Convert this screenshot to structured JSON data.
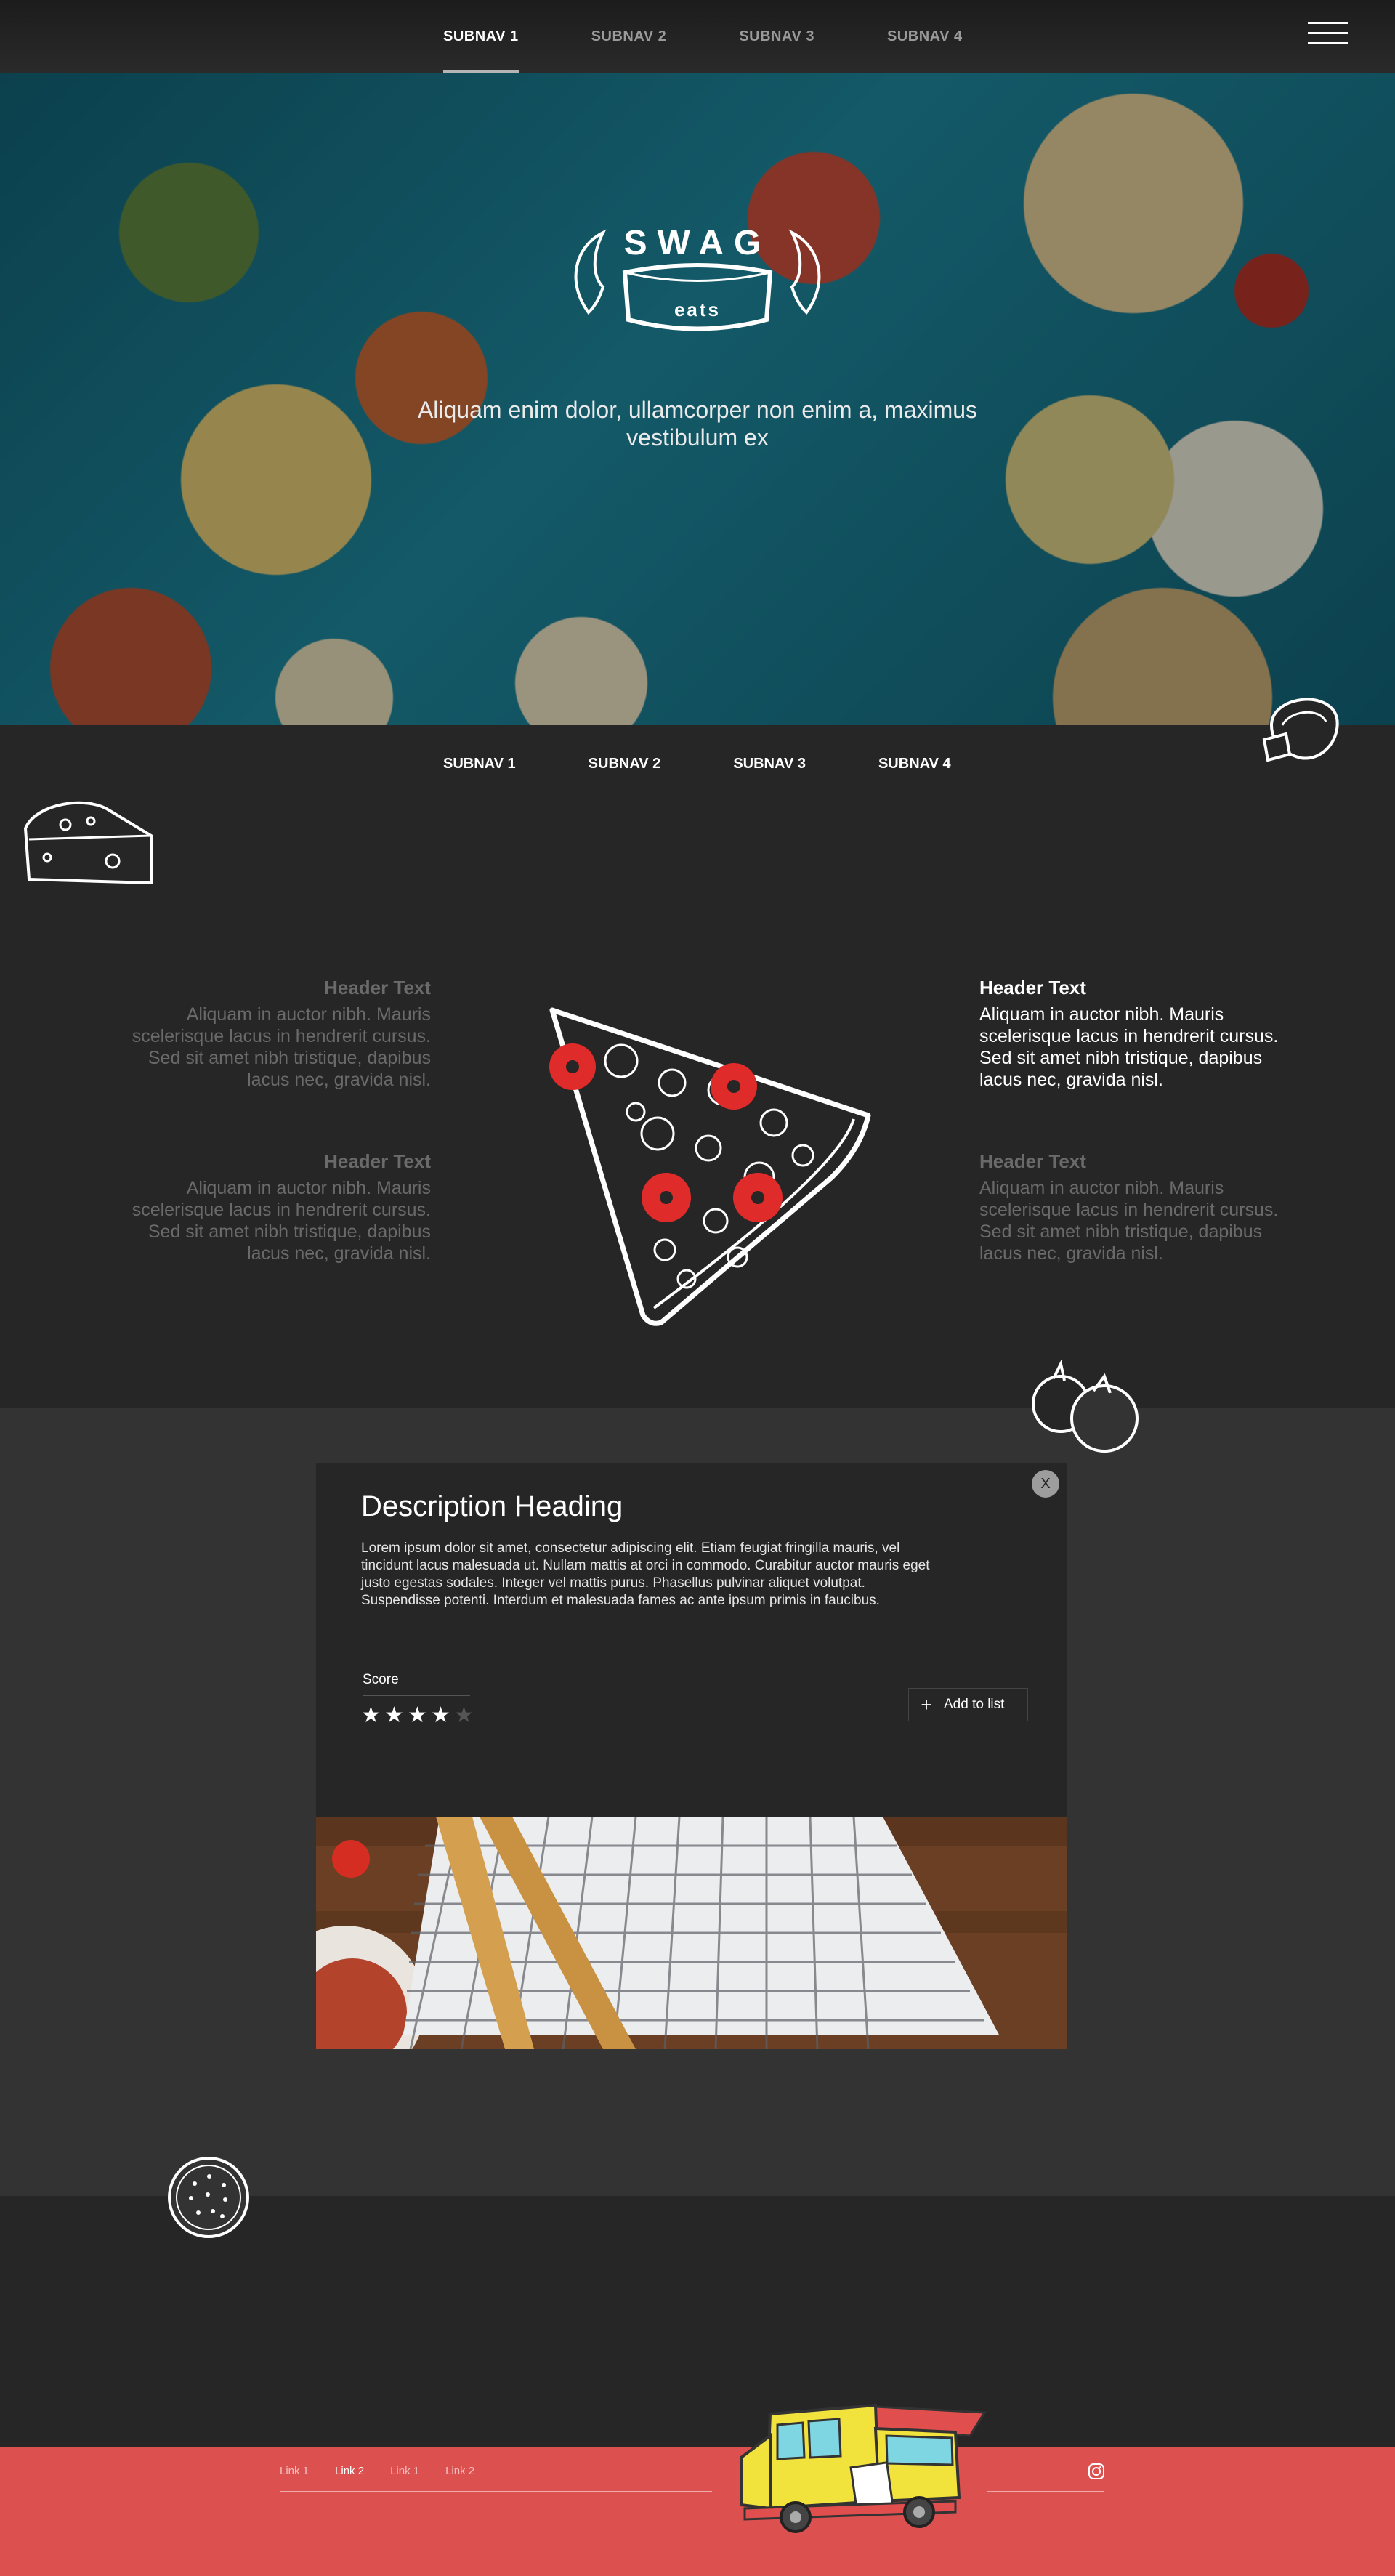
{
  "nav": {
    "items": [
      "SUBNAV 1",
      "SUBNAV 2",
      "SUBNAV 3",
      "SUBNAV 4"
    ],
    "active_index": 0
  },
  "hero": {
    "logo_word": "SWAG",
    "logo_sub": "eats",
    "tagline": "Aliquam enim dolor, ullamcorper non enim a, maximus vestibulum ex"
  },
  "subnav2": {
    "items": [
      "SUBNAV 1",
      "SUBNAV 2",
      "SUBNAV 3",
      "SUBNAV 4"
    ]
  },
  "features": [
    {
      "title": "Header Text",
      "body": "Aliquam in auctor nibh. Mauris scelerisque lacus in hendrerit cursus. Sed sit amet nibh tristique, dapibus lacus nec, gravida nisl."
    },
    {
      "title": "Header Text",
      "body": "Aliquam in auctor nibh. Mauris scelerisque lacus in hendrerit cursus. Sed sit amet nibh tristique, dapibus lacus nec, gravida nisl."
    },
    {
      "title": "Header Text",
      "body": "Aliquam in auctor nibh. Mauris scelerisque lacus in hendrerit cursus. Sed sit amet nibh tristique, dapibus lacus nec, gravida nisl."
    },
    {
      "title": "Header Text",
      "body": "Aliquam in auctor nibh. Mauris scelerisque lacus in hendrerit cursus. Sed sit amet nibh tristique, dapibus lacus nec, gravida nisl."
    }
  ],
  "card": {
    "close_label": "X",
    "heading": "Description Heading",
    "description": "Lorem ipsum dolor sit amet, consectetur adipiscing elit. Etiam feugiat fringilla mauris, vel tincidunt lacus malesuada ut. Nullam mattis at orci in commodo. Curabitur auctor mauris eget justo egestas sodales. Integer vel mattis purus. Phasellus pulvinar aliquet volutpat. Suspendisse potenti. Interdum et malesuada fames ac ante ipsum primis in faucibus.",
    "score_label": "Score",
    "score": 4,
    "score_max": 5,
    "add_label": "Add to list",
    "add_icon": "+"
  },
  "footer": {
    "links": [
      "Link 1",
      "Link 2",
      "Link 1",
      "Link 2"
    ],
    "active_index": 1,
    "social_icon": "instagram-icon"
  },
  "colors": {
    "background": "#262626",
    "band": "#333333",
    "accent_red": "#dc5050",
    "pepperoni": "#e02b2b",
    "truck_yellow": "#f2e23c"
  }
}
